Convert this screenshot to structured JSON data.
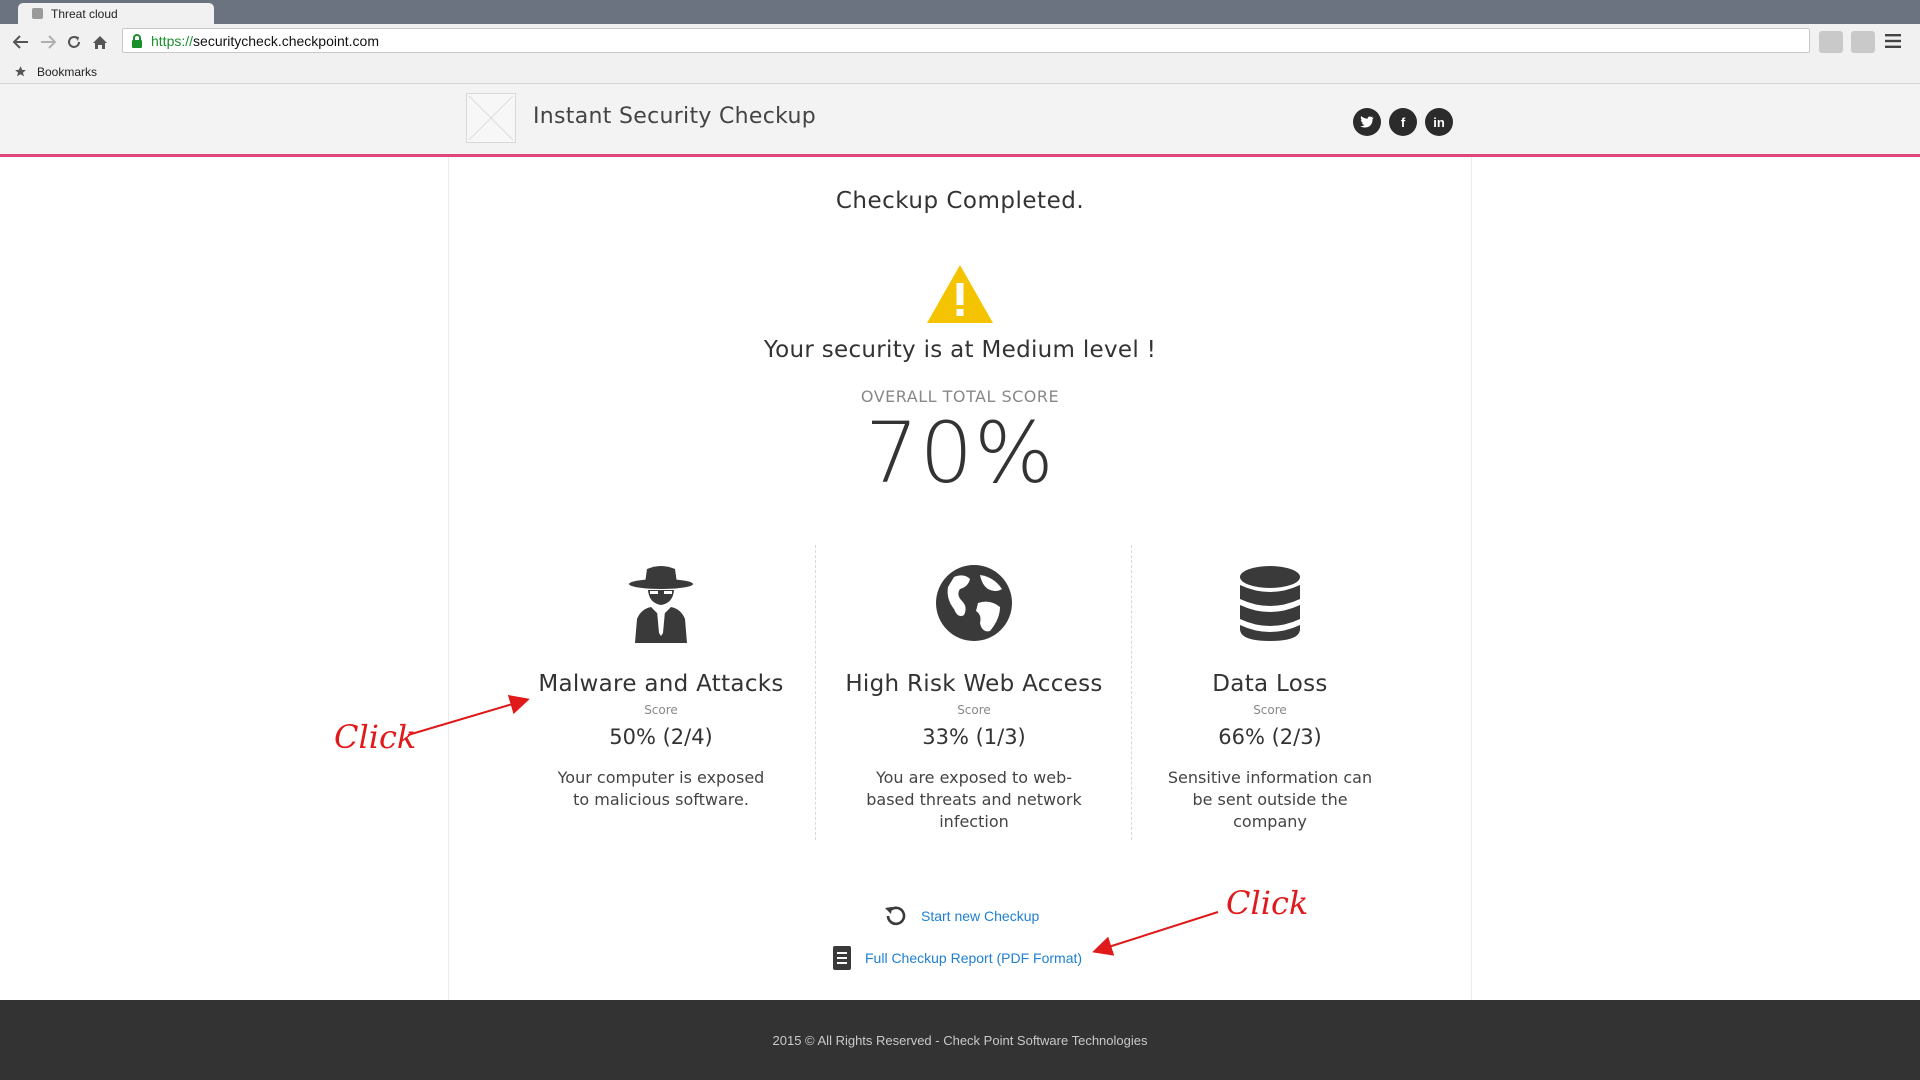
{
  "browser": {
    "tab_title": "Threat cloud",
    "url_scheme": "https://",
    "url_host": "securitycheck.checkpoint.com",
    "bookmarks_label": "Bookmarks"
  },
  "header": {
    "title": "Instant Security Checkup",
    "social": [
      {
        "name": "twitter",
        "glyph": "t"
      },
      {
        "name": "facebook",
        "glyph": "f"
      },
      {
        "name": "linkedin",
        "glyph": "in"
      }
    ],
    "accent_color": "#e0467c"
  },
  "result": {
    "completed": "Checkup Completed.",
    "level_text": "Your security is at Medium level !",
    "overall_label": "OVERALL TOTAL SCORE",
    "overall_score": "70%",
    "warning_color": "#f5c400"
  },
  "categories": [
    {
      "icon": "spy-icon",
      "title": "Malware and Attacks",
      "score_label": "Score",
      "score": "50% (2/4)",
      "description": "Your computer is exposed to malicious software."
    },
    {
      "icon": "globe-icon",
      "title": "High Risk Web Access",
      "score_label": "Score",
      "score": "33% (1/3)",
      "description": "You are exposed to web-based threats and network infection"
    },
    {
      "icon": "database-icon",
      "title": "Data Loss",
      "score_label": "Score",
      "score": "66% (2/3)",
      "description": "Sensitive information can be sent outside the company"
    }
  ],
  "actions": {
    "new_checkup": "Start new Checkup",
    "full_report": "Full Checkup Report (PDF Format)"
  },
  "annotations": {
    "click_left": "Click",
    "click_right": "Click",
    "color": "#e0191b"
  },
  "footer": {
    "text": "2015 © All Rights Reserved - Check Point Software Technologies"
  }
}
